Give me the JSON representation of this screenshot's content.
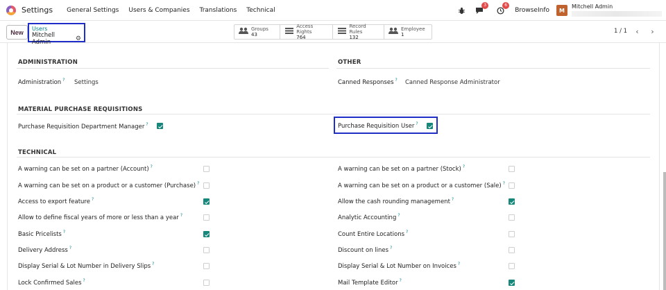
{
  "navbar": {
    "app_name": "Settings",
    "menu": [
      "General Settings",
      "Users & Companies",
      "Translations",
      "Technical"
    ],
    "bug_icon": "bug-icon",
    "messages_count": "3",
    "activities_count": "6",
    "company": "BrowseInfo",
    "user_name": "Mitchell Admin"
  },
  "control": {
    "new_label": "New",
    "breadcrumb_parent": "Users",
    "breadcrumb_current": "Mitchell Admin",
    "stats": [
      {
        "icon": "groups-icon",
        "label": "Groups",
        "value": "43"
      },
      {
        "icon": "list-icon",
        "label": "Access Rights",
        "value": "764"
      },
      {
        "icon": "list-icon",
        "label": "Record Rules",
        "value": "132"
      },
      {
        "icon": "users-icon",
        "label": "Employee",
        "value": "1"
      }
    ],
    "pager": "1 / 1"
  },
  "form": {
    "administration": {
      "title": "ADMINISTRATION",
      "label": "Administration",
      "value": "Settings"
    },
    "other": {
      "title": "OTHER",
      "label": "Canned Responses",
      "value": "Canned Response Administrator"
    },
    "mpr": {
      "title": "MATERIAL PURCHASE REQUISITIONS",
      "left_label": "Purchase Requisition Department Manager",
      "left_checked": true,
      "right_label": "Purchase Requisition User",
      "right_checked": true
    },
    "technical": {
      "title": "TECHNICAL",
      "left": [
        {
          "label": "A warning can be set on a partner (Account)",
          "checked": false
        },
        {
          "label": "A warning can be set on a product or a customer (Purchase)",
          "checked": false
        },
        {
          "label": "Access to export feature",
          "checked": true
        },
        {
          "label": "Allow to define fiscal years of more or less than a year",
          "checked": false
        },
        {
          "label": "Basic Pricelists",
          "checked": true
        },
        {
          "label": "Delivery Address",
          "checked": false
        },
        {
          "label": "Display Serial & Lot Number in Delivery Slips",
          "checked": false
        },
        {
          "label": "Lock Confirmed Sales",
          "checked": false
        }
      ],
      "right": [
        {
          "label": "A warning can be set on a partner (Stock)",
          "checked": false
        },
        {
          "label": "A warning can be set on a product or a customer (Sale)",
          "checked": false
        },
        {
          "label": "Allow the cash rounding management",
          "checked": true
        },
        {
          "label": "Analytic Accounting",
          "checked": false
        },
        {
          "label": "Count Entire Locations",
          "checked": false
        },
        {
          "label": "Discount on lines",
          "checked": false
        },
        {
          "label": "Display Serial & Lot Number on Invoices",
          "checked": false
        },
        {
          "label": "Mail Template Editor",
          "checked": true
        }
      ]
    }
  },
  "colors": {
    "accent": "#017e84",
    "checkbox_on": "#17877b",
    "highlight": "#1f2ec7",
    "badge": "#e34a4a"
  }
}
